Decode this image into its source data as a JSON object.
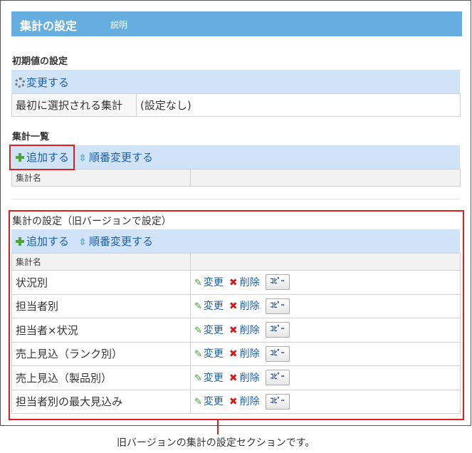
{
  "header": {
    "title": "集計の設定",
    "help_link": "説明"
  },
  "defaults": {
    "section_title": "初期値の設定",
    "change_link": "変更する",
    "row_label": "最初に選択される集計",
    "row_value": "(設定なし)"
  },
  "list": {
    "section_title": "集計一覧",
    "add_link": "追加する",
    "reorder_link": "順番変更する",
    "col_name": "集計名"
  },
  "legacy": {
    "section_title": "集計の設定（旧バージョンで設定）",
    "add_link": "追加する",
    "reorder_link": "順番変更する",
    "col_name": "集計名",
    "edit_label": "変更",
    "delete_label": "削除",
    "copy_label": "ｺﾋﾟｰ",
    "rows": [
      {
        "name": "状況別"
      },
      {
        "name": "担当者別"
      },
      {
        "name": "担当者×状況"
      },
      {
        "name": "売上見込（ランク別）"
      },
      {
        "name": "売上見込（製品別）"
      },
      {
        "name": "担当者別の最大見込み"
      }
    ]
  },
  "callout": "旧バージョンの集計の設定セクションです。",
  "colors": {
    "header": "#66aee0",
    "bar": "#d0e3f7",
    "highlight": "#e21d1d",
    "link": "#1d5fa8"
  },
  "icons": {
    "change": "gear-icon",
    "add": "plus-icon",
    "reorder": "updown-arrow-icon",
    "edit": "pencil-icon",
    "delete": "x-icon"
  }
}
